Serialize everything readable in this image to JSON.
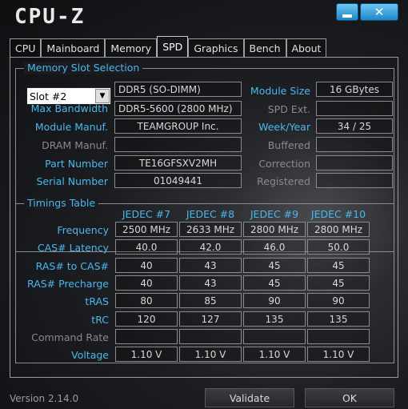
{
  "app_title": "CPU-Z",
  "window_buttons": {
    "minimize_icon": "minimize-icon",
    "close_glyph": "✕"
  },
  "tabs": [
    "CPU",
    "Mainboard",
    "Memory",
    "SPD",
    "Graphics",
    "Bench",
    "About"
  ],
  "active_tab": "SPD",
  "memory_slot": {
    "legend": "Memory Slot Selection",
    "slot_value": "Slot #2",
    "dropdown_arrow": "▼",
    "type": "DDR5 (SO-DIMM)",
    "module_size_label": "Module Size",
    "module_size": "16 GBytes",
    "max_bandwidth_label": "Max Bandwidth",
    "max_bandwidth": "DDR5-5600 (2800 MHz)",
    "spd_ext_label": "SPD Ext.",
    "spd_ext": "",
    "module_manuf_label": "Module Manuf.",
    "module_manuf": "TEAMGROUP Inc.",
    "week_year_label": "Week/Year",
    "week_year": "34 / 25",
    "dram_manuf_label": "DRAM Manuf.",
    "dram_manuf": "",
    "buffered_label": "Buffered",
    "buffered": "",
    "part_number_label": "Part Number",
    "part_number": "TE16GFSXV2MH",
    "correction_label": "Correction",
    "correction": "",
    "serial_number_label": "Serial Number",
    "serial_number": "01049441",
    "registered_label": "Registered",
    "registered": ""
  },
  "timings": {
    "legend": "Timings Table",
    "columns": [
      "JEDEC #7",
      "JEDEC #8",
      "JEDEC #9",
      "JEDEC #10"
    ],
    "rows": [
      {
        "label": "Frequency",
        "values": [
          "2500 MHz",
          "2633 MHz",
          "2800 MHz",
          "2800 MHz"
        ]
      },
      {
        "label": "CAS# Latency",
        "values": [
          "40.0",
          "42.0",
          "46.0",
          "50.0"
        ]
      },
      {
        "label": "RAS# to CAS#",
        "values": [
          "40",
          "43",
          "45",
          "45"
        ]
      },
      {
        "label": "RAS# Precharge",
        "values": [
          "40",
          "43",
          "45",
          "45"
        ]
      },
      {
        "label": "tRAS",
        "values": [
          "80",
          "85",
          "90",
          "90"
        ]
      },
      {
        "label": "tRC",
        "values": [
          "120",
          "127",
          "135",
          "135"
        ]
      },
      {
        "label": "Command Rate",
        "values": [
          "",
          "",
          "",
          ""
        ]
      },
      {
        "label": "Voltage",
        "values": [
          "1.10 V",
          "1.10 V",
          "1.10 V",
          "1.10 V"
        ]
      }
    ]
  },
  "footer": {
    "version": "Version 2.14.0",
    "validate_label": "Validate",
    "ok_label": "OK"
  }
}
